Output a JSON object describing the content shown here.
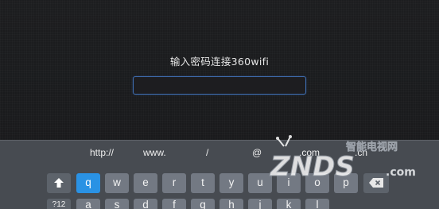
{
  "dialog": {
    "prompt": "输入密码连接360wifi",
    "password_value": ""
  },
  "keyboard": {
    "shortcuts": [
      "http://",
      "www.",
      "/",
      "@",
      ".com",
      ".cn"
    ],
    "row1": [
      "q",
      "w",
      "e",
      "r",
      "t",
      "y",
      "u",
      "i",
      "o",
      "p"
    ],
    "row2_left": "?12",
    "row2": [
      "a",
      "s",
      "d",
      "f",
      "g",
      "h",
      "j",
      "k",
      "l"
    ],
    "active_key": "q",
    "shift_icon": "shift-arrow-up-icon",
    "backspace_icon": "backspace-icon"
  },
  "watermark": {
    "top_text": "智能电视网",
    "brand": "ZNDS",
    "domain": ".com"
  },
  "colors": {
    "accent": "#2a92e4",
    "input_border": "#3f6fb3",
    "key": "#737983",
    "keyboard_bg": "#474b51"
  }
}
